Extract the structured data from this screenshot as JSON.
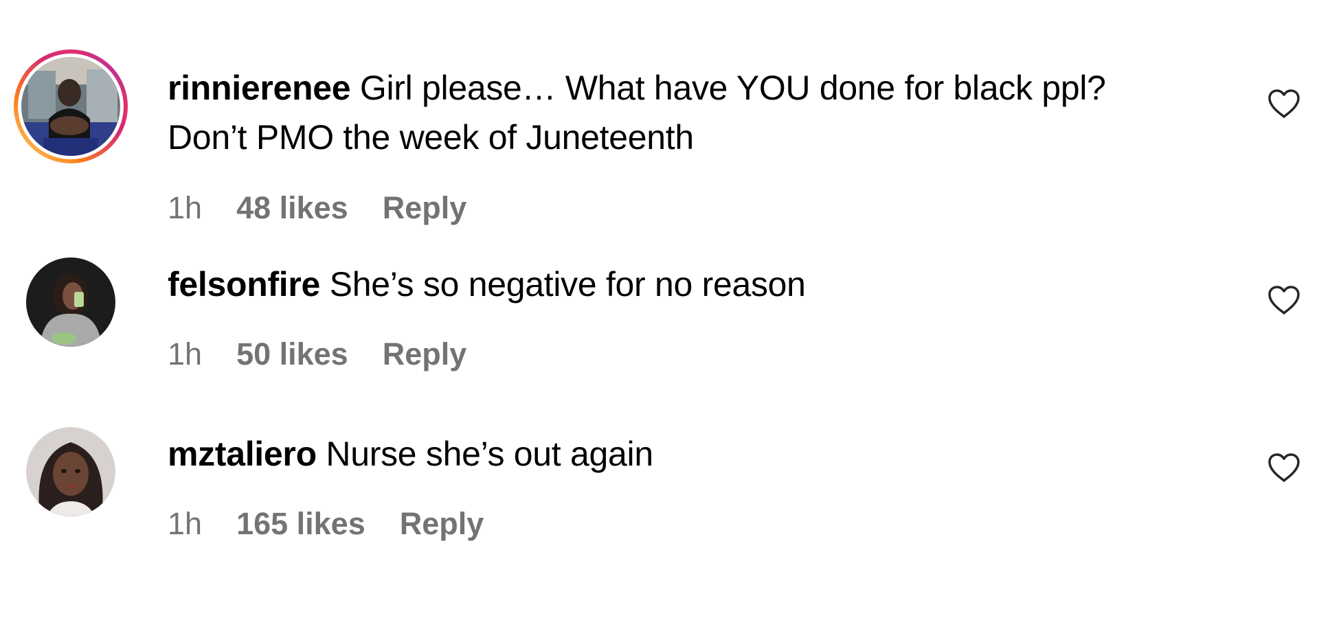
{
  "comments": [
    {
      "username": "rinnierenee",
      "text_line1": "Girl please… What have YOU done for black ppl?",
      "text_line2": "Don’t PMO the week of Juneteenth",
      "time": "1h",
      "likes": "48 likes",
      "reply": "Reply",
      "has_story_ring": true,
      "avatar_icon": "user-avatar-photo",
      "like_icon": "heart-outline-icon"
    },
    {
      "username": "felsonfire",
      "text_line1": "She’s so negative for no reason",
      "time": "1h",
      "likes": "50 likes",
      "reply": "Reply",
      "has_story_ring": false,
      "avatar_icon": "user-avatar-photo",
      "like_icon": "heart-outline-icon"
    },
    {
      "username": "mztaliero",
      "text_line1": "Nurse she’s out again",
      "time": "1h",
      "likes": "165 likes",
      "reply": "Reply",
      "has_story_ring": false,
      "avatar_icon": "user-avatar-photo",
      "like_icon": "heart-outline-icon"
    }
  ],
  "colors": {
    "text": "#000000",
    "meta": "#737373",
    "background": "#ffffff"
  }
}
